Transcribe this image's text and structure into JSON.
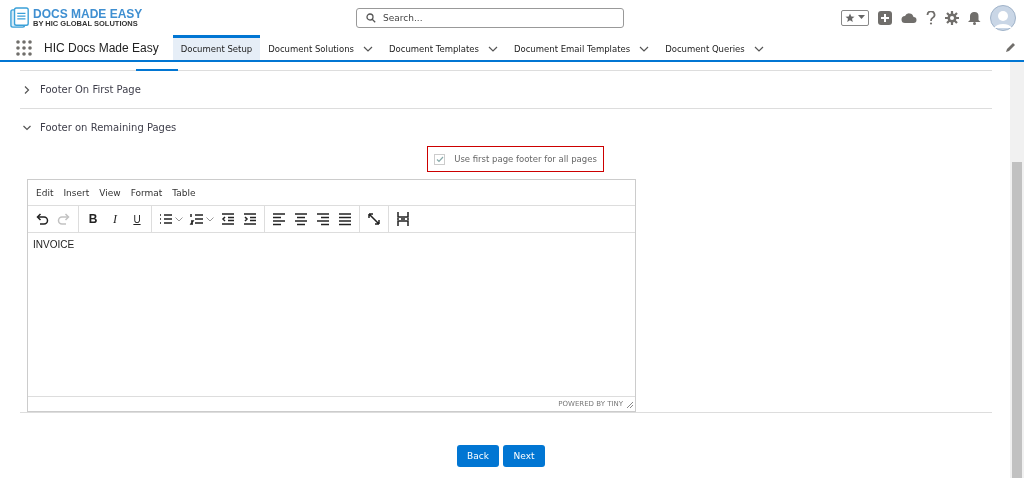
{
  "header": {
    "logo_title": "DOCS MADE EASY",
    "logo_subtitle": "BY HIC GLOBAL SOLUTIONS",
    "search": {
      "placeholder": "Search..."
    }
  },
  "nav": {
    "app_name": "HIC Docs Made Easy",
    "tabs": [
      {
        "label": "Document Setup",
        "selected": true,
        "dropdown": false
      },
      {
        "label": "Document Solutions",
        "selected": false,
        "dropdown": true
      },
      {
        "label": "Document Templates",
        "selected": false,
        "dropdown": true
      },
      {
        "label": "Document Email Templates",
        "selected": false,
        "dropdown": true
      },
      {
        "label": "Document Queries",
        "selected": false,
        "dropdown": true
      }
    ]
  },
  "sections": [
    {
      "title": "Footer On First Page",
      "expanded": false
    },
    {
      "title": "Footer on Remaining Pages",
      "expanded": true
    }
  ],
  "option": {
    "label": "Use first page footer for all pages",
    "checked": true
  },
  "editor": {
    "menu": [
      "Edit",
      "Insert",
      "View",
      "Format",
      "Table"
    ],
    "toolbar": [
      [
        {
          "kind": "undo",
          "disabled": false
        },
        {
          "kind": "redo",
          "disabled": true
        }
      ],
      [
        {
          "kind": "bold",
          "label": "B",
          "disabled": false
        },
        {
          "kind": "italic",
          "label": "I",
          "disabled": false
        },
        {
          "kind": "underline",
          "label": "U",
          "disabled": false
        }
      ],
      [
        {
          "kind": "bullets",
          "disabled": false
        },
        {
          "kind": "caret",
          "disabled": false
        },
        {
          "kind": "numbers",
          "disabled": false
        },
        {
          "kind": "caret",
          "disabled": false
        },
        {
          "kind": "outdent",
          "disabled": false
        },
        {
          "kind": "indent",
          "disabled": false
        }
      ],
      [
        {
          "kind": "align-left",
          "disabled": false
        },
        {
          "kind": "align-center",
          "disabled": false
        },
        {
          "kind": "align-right",
          "disabled": false
        },
        {
          "kind": "justify",
          "disabled": false
        }
      ],
      [
        {
          "kind": "fullscreen",
          "disabled": false
        }
      ],
      [
        {
          "kind": "pagebreak",
          "disabled": false
        }
      ]
    ],
    "content": "INVOICE",
    "status": "POWERED BY TINY"
  },
  "buttons": [
    "Back",
    "Next"
  ]
}
